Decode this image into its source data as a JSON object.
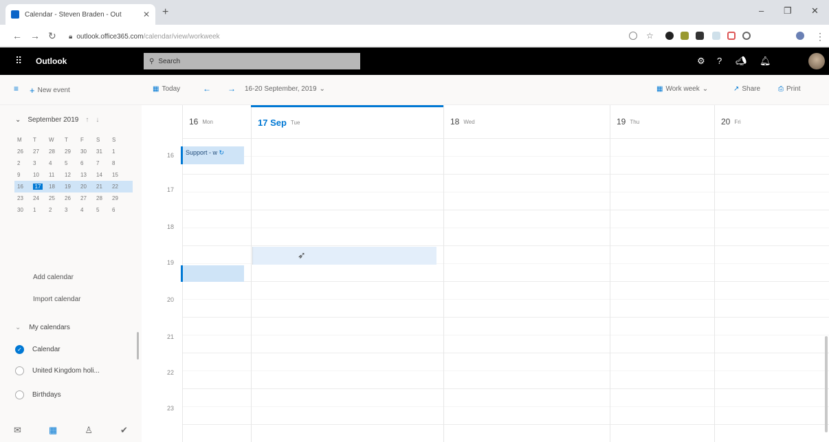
{
  "browser": {
    "tab_title": "Calendar - Steven Braden - Out",
    "url_domain": "outlook.office365.com",
    "url_path": "/calendar/view/workweek"
  },
  "header": {
    "app_name": "Outlook",
    "search_placeholder": "Search"
  },
  "commandbar": {
    "new_event": "New event",
    "today": "Today",
    "date_range": "16-20 September, 2019",
    "view": "Work week",
    "share": "Share",
    "print": "Print"
  },
  "minical": {
    "month_label": "September 2019",
    "weekdays": [
      "M",
      "T",
      "W",
      "T",
      "F",
      "S",
      "S"
    ],
    "weeks": [
      [
        "26",
        "27",
        "28",
        "29",
        "30",
        "31",
        "1"
      ],
      [
        "2",
        "3",
        "4",
        "5",
        "6",
        "7",
        "8"
      ],
      [
        "9",
        "10",
        "11",
        "12",
        "13",
        "14",
        "15"
      ],
      [
        "16",
        "17",
        "18",
        "19",
        "20",
        "21",
        "22"
      ],
      [
        "23",
        "24",
        "25",
        "26",
        "27",
        "28",
        "29"
      ],
      [
        "30",
        "1",
        "2",
        "3",
        "4",
        "5",
        "6"
      ]
    ]
  },
  "leftpane": {
    "add_calendar": "Add calendar",
    "import_calendar": "Import calendar",
    "my_calendars": "My calendars",
    "calendars": [
      "Calendar",
      "United Kingdom holi...",
      "Birthdays"
    ]
  },
  "days": [
    {
      "num": "16",
      "name": "Mon"
    },
    {
      "num": "17 Sep",
      "name": "Tue"
    },
    {
      "num": "18",
      "name": "Wed"
    },
    {
      "num": "19",
      "name": "Thu"
    },
    {
      "num": "20",
      "name": "Fri"
    }
  ],
  "hours": [
    "16",
    "17",
    "18",
    "19",
    "20",
    "21",
    "22",
    "23"
  ],
  "events": {
    "support_title": "Support - w"
  },
  "colors": {
    "accent": "#0078d4",
    "event_bg": "#cfe4f7"
  }
}
